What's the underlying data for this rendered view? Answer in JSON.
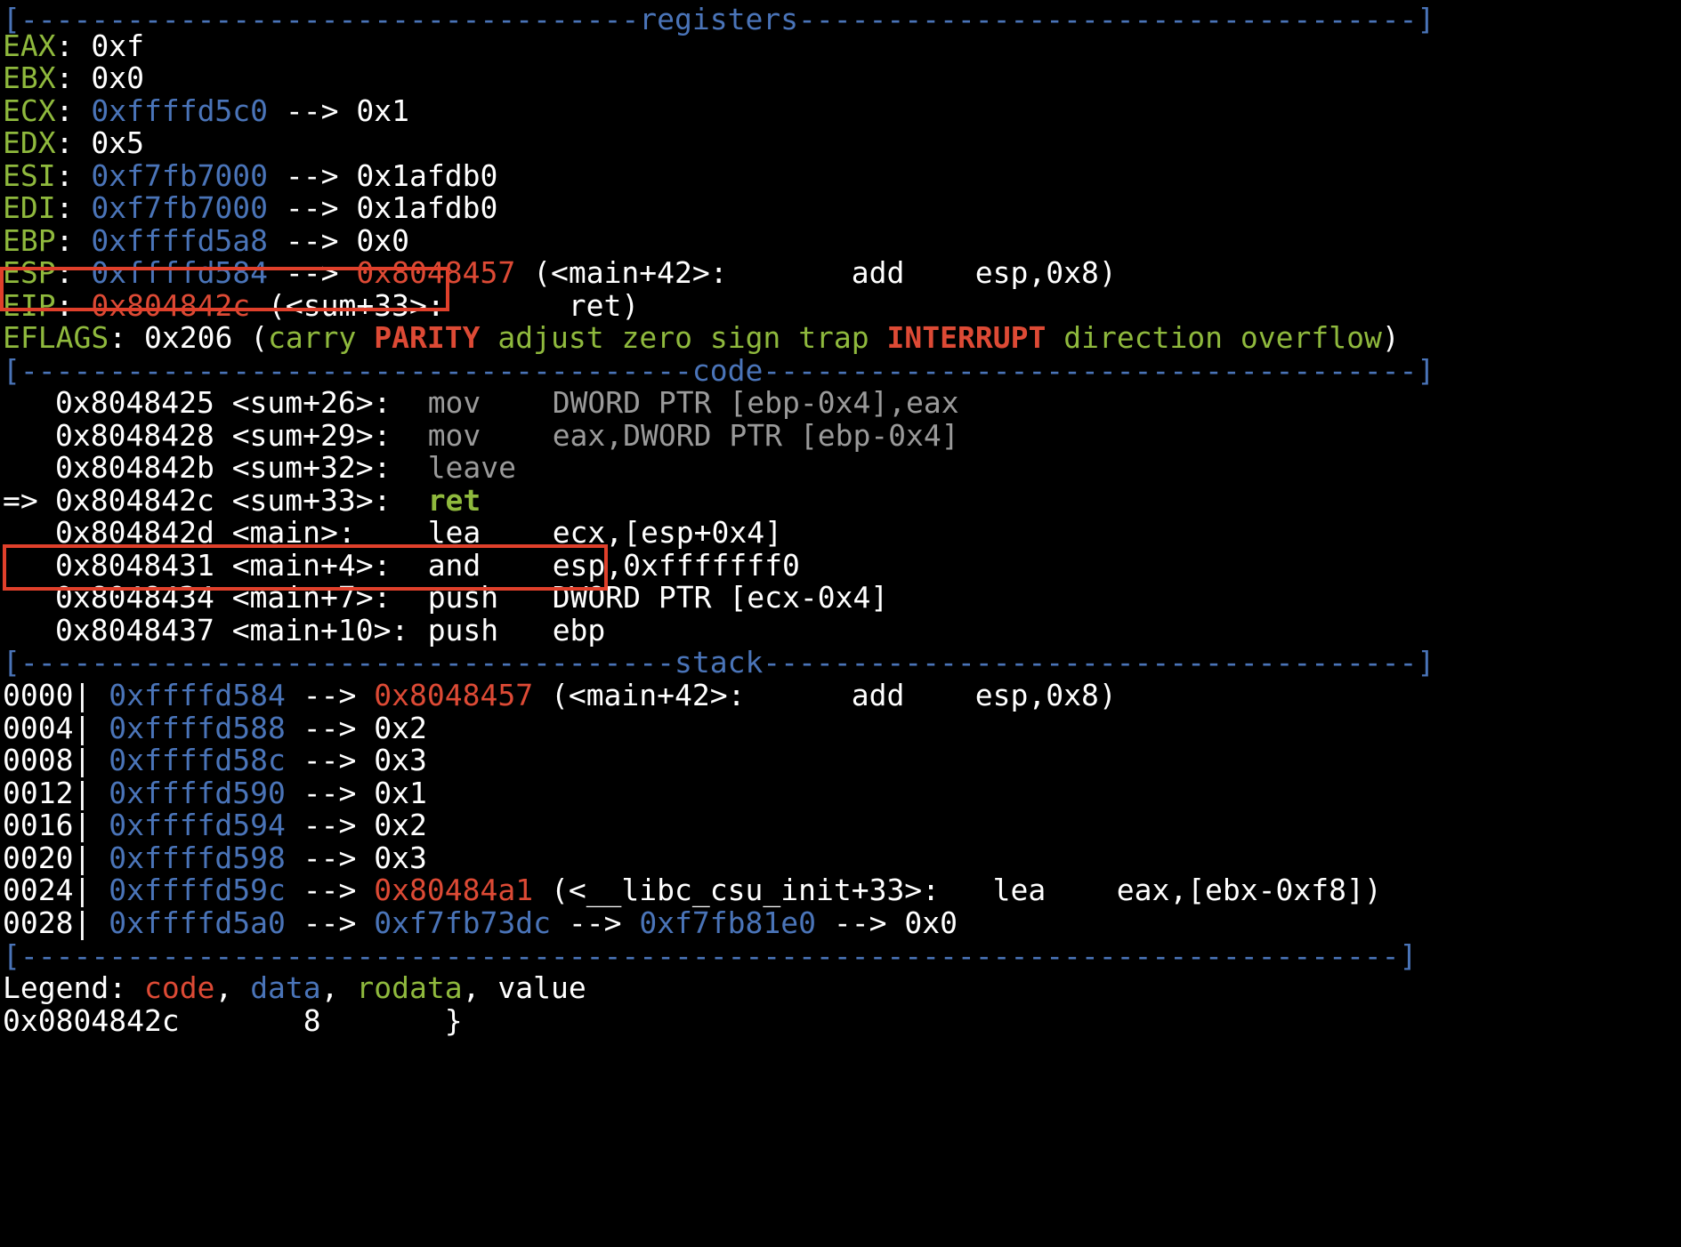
{
  "colors": {
    "background": "#000000",
    "text": "#ffffff",
    "label": "#8fb93d",
    "data": "#4a74b8",
    "code": "#dd4a35",
    "disasm": "#9a9a9a",
    "highlight": "#e0402b"
  },
  "headers": {
    "registers": "[-----------------------------------registers-----------------------------------]",
    "code": "[--------------------------------------code-------------------------------------]",
    "stack": "[-------------------------------------stack-------------------------------------]",
    "footer": "[------------------------------------------------------------------------------]"
  },
  "registers": {
    "eax": {
      "name": "EAX",
      "value": "0xf"
    },
    "ebx": {
      "name": "EBX",
      "value": "0x0"
    },
    "ecx": {
      "name": "ECX",
      "addr": "0xffffd5c0",
      "arrow": "-->",
      "value": "0x1"
    },
    "edx": {
      "name": "EDX",
      "value": "0x5"
    },
    "esi": {
      "name": "ESI",
      "addr": "0xf7fb7000",
      "arrow": "-->",
      "value": "0x1afdb0"
    },
    "edi": {
      "name": "EDI",
      "addr": "0xf7fb7000",
      "arrow": "-->",
      "value": "0x1afdb0"
    },
    "ebp": {
      "name": "EBP",
      "addr": "0xffffd5a8",
      "arrow": "-->",
      "value": "0x0"
    },
    "esp": {
      "name": "ESP",
      "addr": "0xffffd584",
      "arrow": "-->",
      "target": "0x8048457",
      "rest": "(<main+42>:       add    esp,0x8)"
    },
    "eip": {
      "name": "EIP",
      "target": "0x804842c",
      "rest": "(<sum+33>:       ret)"
    },
    "eflags": {
      "name": "EFLAGS",
      "value": "0x206",
      "open": "(",
      "carry": "carry",
      "parity": "PARITY",
      "adjust": "adjust",
      "zero": "zero",
      "sign": "sign",
      "trap": "trap",
      "interrupt": "INTERRUPT",
      "direction": "direction",
      "overflow": "overflow",
      "close": ")"
    }
  },
  "code": [
    {
      "marker": "",
      "addr": "0x8048425",
      "sym": "<sum+26>:",
      "op": "mov",
      "args": "DWORD PTR [ebp-0x4],eax"
    },
    {
      "marker": "",
      "addr": "0x8048428",
      "sym": "<sum+29>:",
      "op": "mov",
      "args": "eax,DWORD PTR [ebp-0x4]"
    },
    {
      "marker": "",
      "addr": "0x804842b",
      "sym": "<sum+32>:",
      "op": "leave",
      "args": ""
    },
    {
      "marker": "=>",
      "addr": "0x804842c",
      "sym": "<sum+33>:",
      "op": "ret",
      "args": ""
    },
    {
      "marker": "",
      "addr": "0x804842d",
      "sym": "<main>:",
      "op": "lea",
      "args": "ecx,[esp+0x4]"
    },
    {
      "marker": "",
      "addr": "0x8048431",
      "sym": "<main+4>:",
      "op": "and",
      "args": "esp,0xfffffff0"
    },
    {
      "marker": "",
      "addr": "0x8048434",
      "sym": "<main+7>:",
      "op": "push",
      "args": "DWORD PTR [ecx-0x4]"
    },
    {
      "marker": "",
      "addr": "0x8048437",
      "sym": "<main+10>:",
      "op": "push",
      "args": "ebp"
    }
  ],
  "stack": [
    {
      "off": "0000|",
      "addr": "0xffffd584",
      "arrow": "-->",
      "v1": "0x8048457",
      "rest": "(<main+42>:      add    esp,0x8)"
    },
    {
      "off": "0004|",
      "addr": "0xffffd588",
      "arrow": "-->",
      "v1": "0x2"
    },
    {
      "off": "0008|",
      "addr": "0xffffd58c",
      "arrow": "-->",
      "v1": "0x3"
    },
    {
      "off": "0012|",
      "addr": "0xffffd590",
      "arrow": "-->",
      "v1": "0x1"
    },
    {
      "off": "0016|",
      "addr": "0xffffd594",
      "arrow": "-->",
      "v1": "0x2"
    },
    {
      "off": "0020|",
      "addr": "0xffffd598",
      "arrow": "-->",
      "v1": "0x3"
    },
    {
      "off": "0024|",
      "addr": "0xffffd59c",
      "arrow": "-->",
      "v1": "0x80484a1",
      "rest": "(<__libc_csu_init+33>:   lea    eax,[ebx-0xf8])"
    },
    {
      "off": "0028|",
      "addr": "0xffffd5a0",
      "arrow": "-->",
      "v1": "0xf7fb73dc",
      "arrow2": "-->",
      "v2": "0xf7fb81e0",
      "arrow3": "-->",
      "v3": "0x0"
    }
  ],
  "legend": {
    "label": "Legend:",
    "code": "code",
    "data": "data",
    "rodata": "rodata",
    "value": "value",
    "sep": ","
  },
  "source": {
    "addr": "0x0804842c",
    "line": "8",
    "text": "}"
  }
}
